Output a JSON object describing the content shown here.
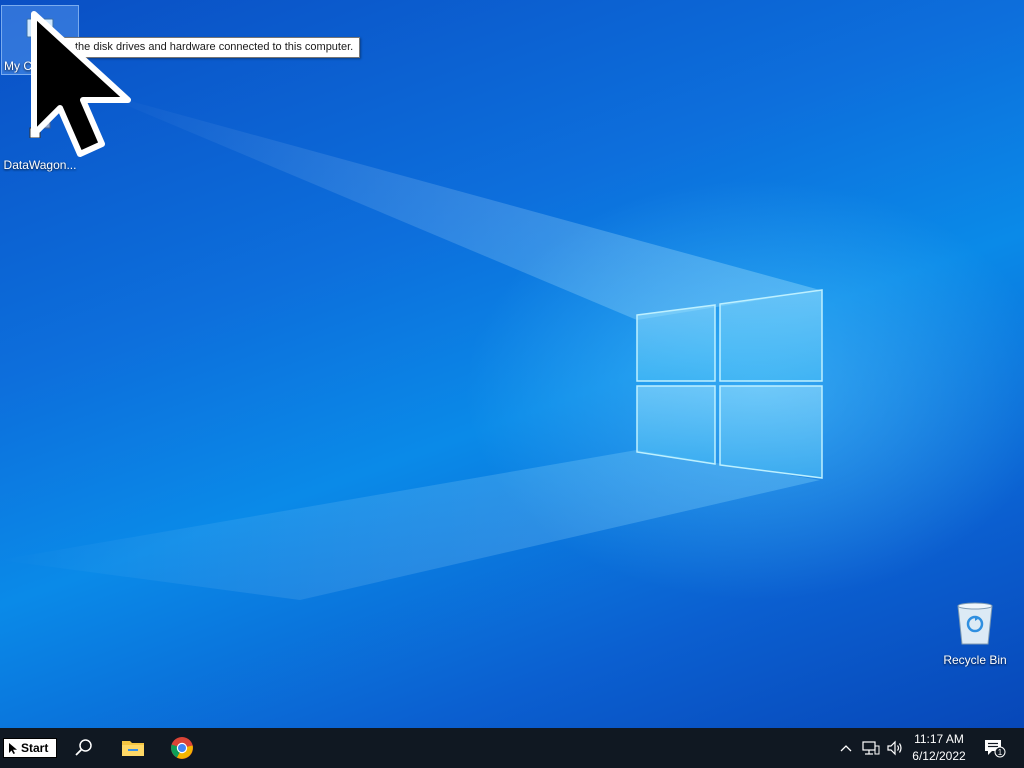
{
  "desktop": {
    "icons": [
      {
        "name": "my-computer",
        "label": "My Computer"
      },
      {
        "name": "datawagon",
        "label": "DataWagon..."
      },
      {
        "name": "recycle-bin",
        "label": "Recycle Bin"
      }
    ],
    "tooltip": "the disk drives and hardware connected to this computer."
  },
  "taskbar": {
    "start_label": "Start",
    "pinned": [
      {
        "name": "search-icon"
      },
      {
        "name": "file-explorer-icon"
      },
      {
        "name": "chrome-icon"
      }
    ],
    "tray": {
      "icons": [
        "show-hidden-icons-chevron-icon",
        "network-icon",
        "volume-icon"
      ],
      "time": "11:17 AM",
      "date": "6/12/2022",
      "notification_count": "1"
    }
  },
  "colors": {
    "wallpaper": "#0a6fdc",
    "taskbar": "#101822",
    "logo_glow": "#7fdcff"
  }
}
